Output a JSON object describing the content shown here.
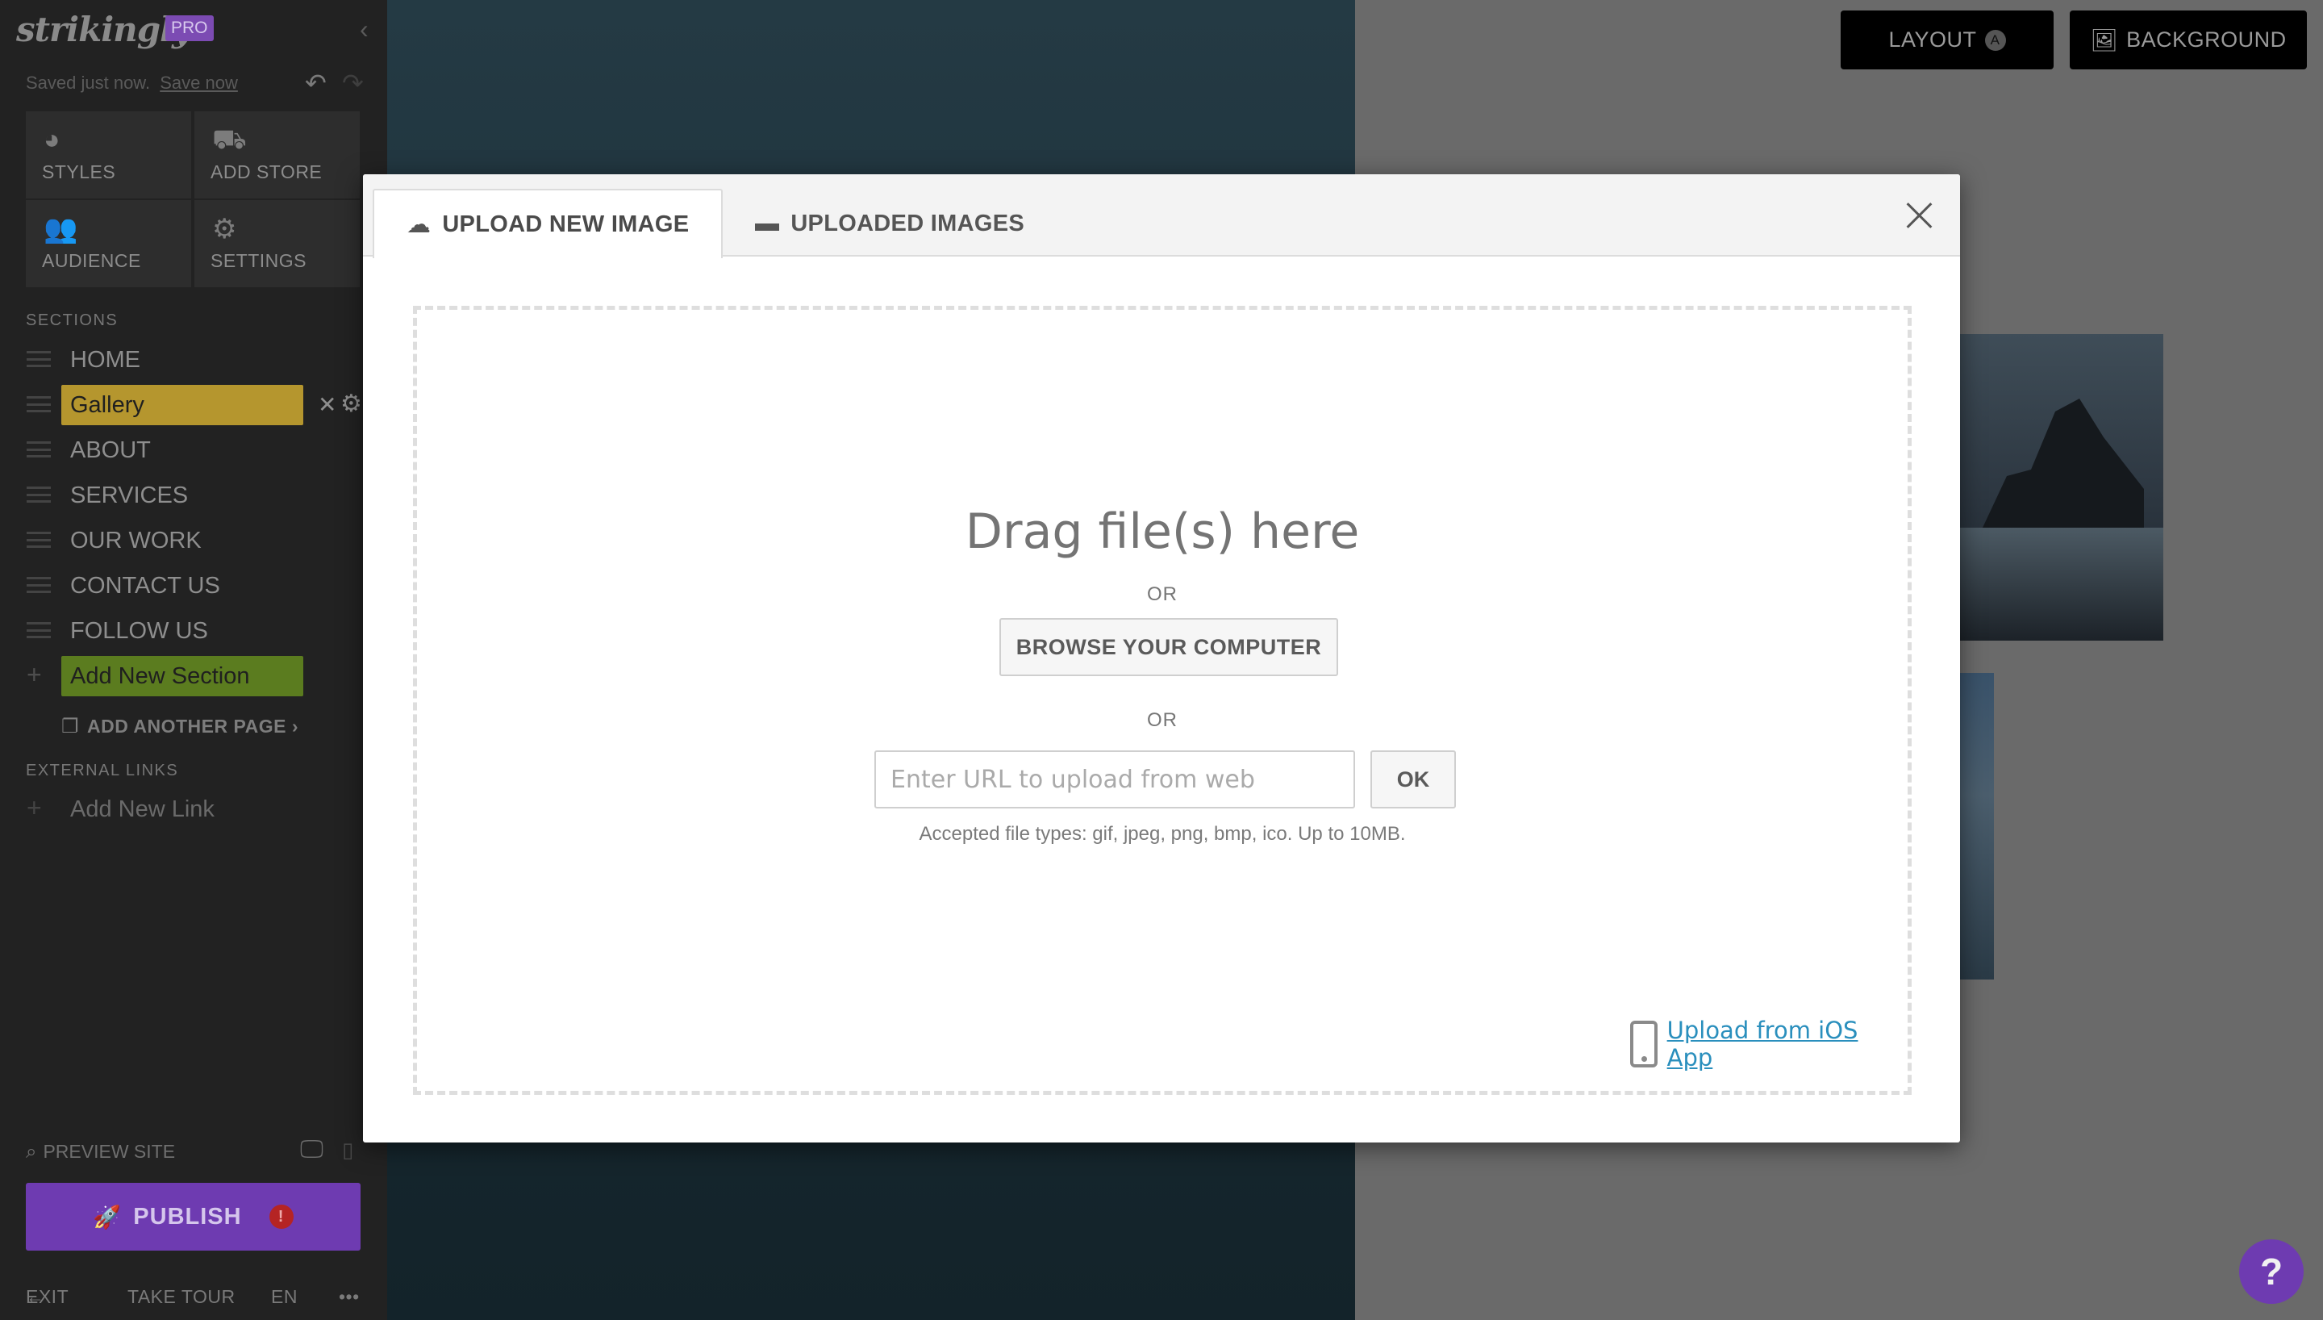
{
  "sidebar": {
    "logo": "strikingly",
    "pro_badge": "PRO",
    "saved_status": "Saved just now.",
    "save_now": "Save now",
    "tools": [
      {
        "label": "STYLES",
        "icon": "palette-icon"
      },
      {
        "label": "ADD STORE",
        "icon": "store-icon"
      },
      {
        "label": "AUDIENCE",
        "icon": "users-icon"
      },
      {
        "label": "SETTINGS",
        "icon": "gear-icon"
      }
    ],
    "sections_heading": "SECTIONS",
    "sections": [
      "HOME",
      "Gallery",
      "ABOUT",
      "SERVICES",
      "OUR WORK",
      "CONTACT US",
      "FOLLOW US"
    ],
    "active_section": "Gallery",
    "add_section": "Add New Section",
    "add_page": "ADD ANOTHER PAGE",
    "external_heading": "EXTERNAL LINKS",
    "add_link": "Add New Link",
    "preview": "PREVIEW SITE",
    "publish": "PUBLISH",
    "publish_alert": "!",
    "bottom": {
      "exit": "EXIT",
      "tour": "TAKE TOUR",
      "lang": "EN",
      "more": "•••"
    }
  },
  "canvas": {
    "layout_button": "LAYOUT",
    "layout_badge": "A",
    "background_button": "BACKGROUND",
    "help": "?"
  },
  "modal": {
    "tabs": [
      {
        "label": "UPLOAD NEW IMAGE",
        "icon": "cloud-upload-icon",
        "active": true
      },
      {
        "label": "UPLOADED IMAGES",
        "icon": "folder-icon",
        "active": false
      }
    ],
    "drag_title": "Drag file(s) here",
    "or": "OR",
    "browse": "BROWSE YOUR COMPUTER",
    "url_placeholder": "Enter URL to upload from web",
    "ok": "OK",
    "accepted": "Accepted file types: gif, jpeg, png, bmp, ico. Up to 10MB.",
    "ios_link": "Upload from iOS App"
  },
  "colors": {
    "accent_purple": "#6e3bb1",
    "active_section": "#b5962e",
    "add_section": "#5b7c1f",
    "link": "#2a8fbd"
  }
}
